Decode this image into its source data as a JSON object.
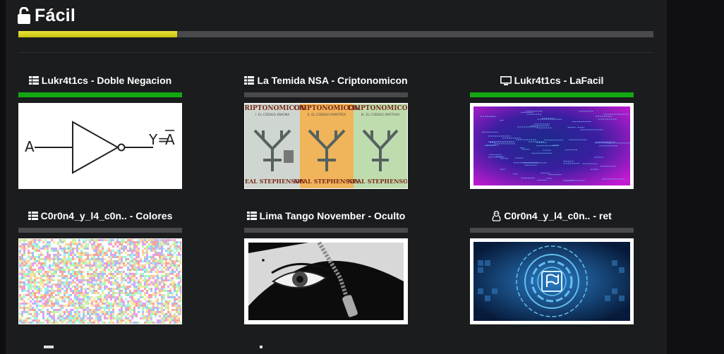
{
  "section": {
    "title": "Fácil",
    "progress_percent": 25
  },
  "cards": [
    {
      "label": "Lukr4t1cs - Doble Negacion",
      "icon": "grid-icon",
      "solved": true,
      "image": "not-gate-diagram"
    },
    {
      "label": "La Temida NSA - Criptonomicon",
      "icon": "grid-icon",
      "solved": false,
      "image": "book-covers",
      "thumb_text": {
        "book_title": "CRIPTONOMICON",
        "author": "NEAL STEPHENSON",
        "subtitles": [
          "I. EL CÓDIGO ENIGMA",
          "II. EL CÓDIGO PONTIFEX",
          "III. EL CÓDIGO ARETUSA"
        ]
      }
    },
    {
      "label": "Lukr4t1cs - LaFacil",
      "icon": "monitor-icon",
      "solved": true,
      "image": "code-tunnel"
    },
    {
      "label": "C0r0n4_y_l4_c0n.. - Colores",
      "icon": "grid-icon",
      "solved": false,
      "image": "color-noise"
    },
    {
      "label": "Lima Tango November - Oculto",
      "icon": "grid-icon",
      "solved": false,
      "image": "zipper-eye"
    },
    {
      "label": "C0r0n4_y_l4_c0n.. - ret",
      "icon": "linux-icon",
      "solved": false,
      "image": "digital-flag"
    }
  ],
  "not_gate": {
    "input": "A",
    "output": "Y=",
    "output_bar": "A"
  },
  "colors": {
    "solved": "#12a812",
    "unsolved": "#4a4a4c",
    "progress": "#dcd520"
  }
}
